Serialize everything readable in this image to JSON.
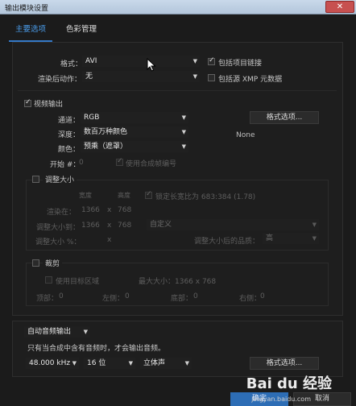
{
  "window": {
    "title": "输出模块设置",
    "close_label": "✕"
  },
  "tabs": [
    {
      "label": "主要选项"
    },
    {
      "label": "色彩管理"
    }
  ],
  "format": {
    "label": "格式：",
    "value": "AVI",
    "include_project_link": "包括项目链接",
    "include_project_link_checked": true
  },
  "post_render": {
    "label": "渲染后动作：",
    "value": "无",
    "include_xmp": "包括源 XMP 元数据",
    "include_xmp_checked": false
  },
  "video": {
    "section_label": "视频输出",
    "checked": true,
    "channel_label": "通道：",
    "channel_value": "RGB",
    "format_options_label": "格式选项...",
    "depth_label": "深度：",
    "depth_value": "数百万种颜色",
    "codec_info": "None",
    "color_label": "颜色：",
    "color_value": "预乘（遮罩）",
    "start_label": "开始 #：",
    "start_value": "0",
    "use_comp_frame": "使用合成帧编号"
  },
  "resize": {
    "label": "调整大小",
    "width_header": "宽度",
    "height_header": "高度",
    "lock_aspect": "锁定长宽比为 683:384 (1.78)",
    "render_at_label": "渲染在：",
    "render_w": "1366",
    "x1": "x",
    "render_h": "768",
    "resize_to_label": "调整大小到：",
    "resize_w": "1366",
    "x2": "x",
    "resize_h": "768",
    "preset_value": "自定义",
    "resize_pct_label": "调整大小 %：",
    "x3": "x",
    "quality_label": "调整大小后的品质：",
    "quality_value": "高"
  },
  "crop": {
    "label": "裁剪",
    "use_roi": "使用目标区域",
    "max_size": "最大大小：1366 x 768",
    "top_label": "顶部：",
    "top_value": "0",
    "left_label": "左侧：",
    "left_value": "0",
    "bottom_label": "底部：",
    "bottom_value": "0",
    "right_label": "右侧：",
    "right_value": "0"
  },
  "audio": {
    "mode_value": "自动音频输出",
    "note": "只有当合成中含有音频时，才会输出音频。",
    "rate_value": "48.000 kHz",
    "bits_value": "16 位",
    "channels_value": "立体声",
    "format_options_label": "格式选项..."
  },
  "footer": {
    "ok_label": "确定",
    "cancel_label": "取消"
  },
  "watermark": {
    "logo": "Bai du 经验",
    "url": "jingyan.baidu.com"
  }
}
